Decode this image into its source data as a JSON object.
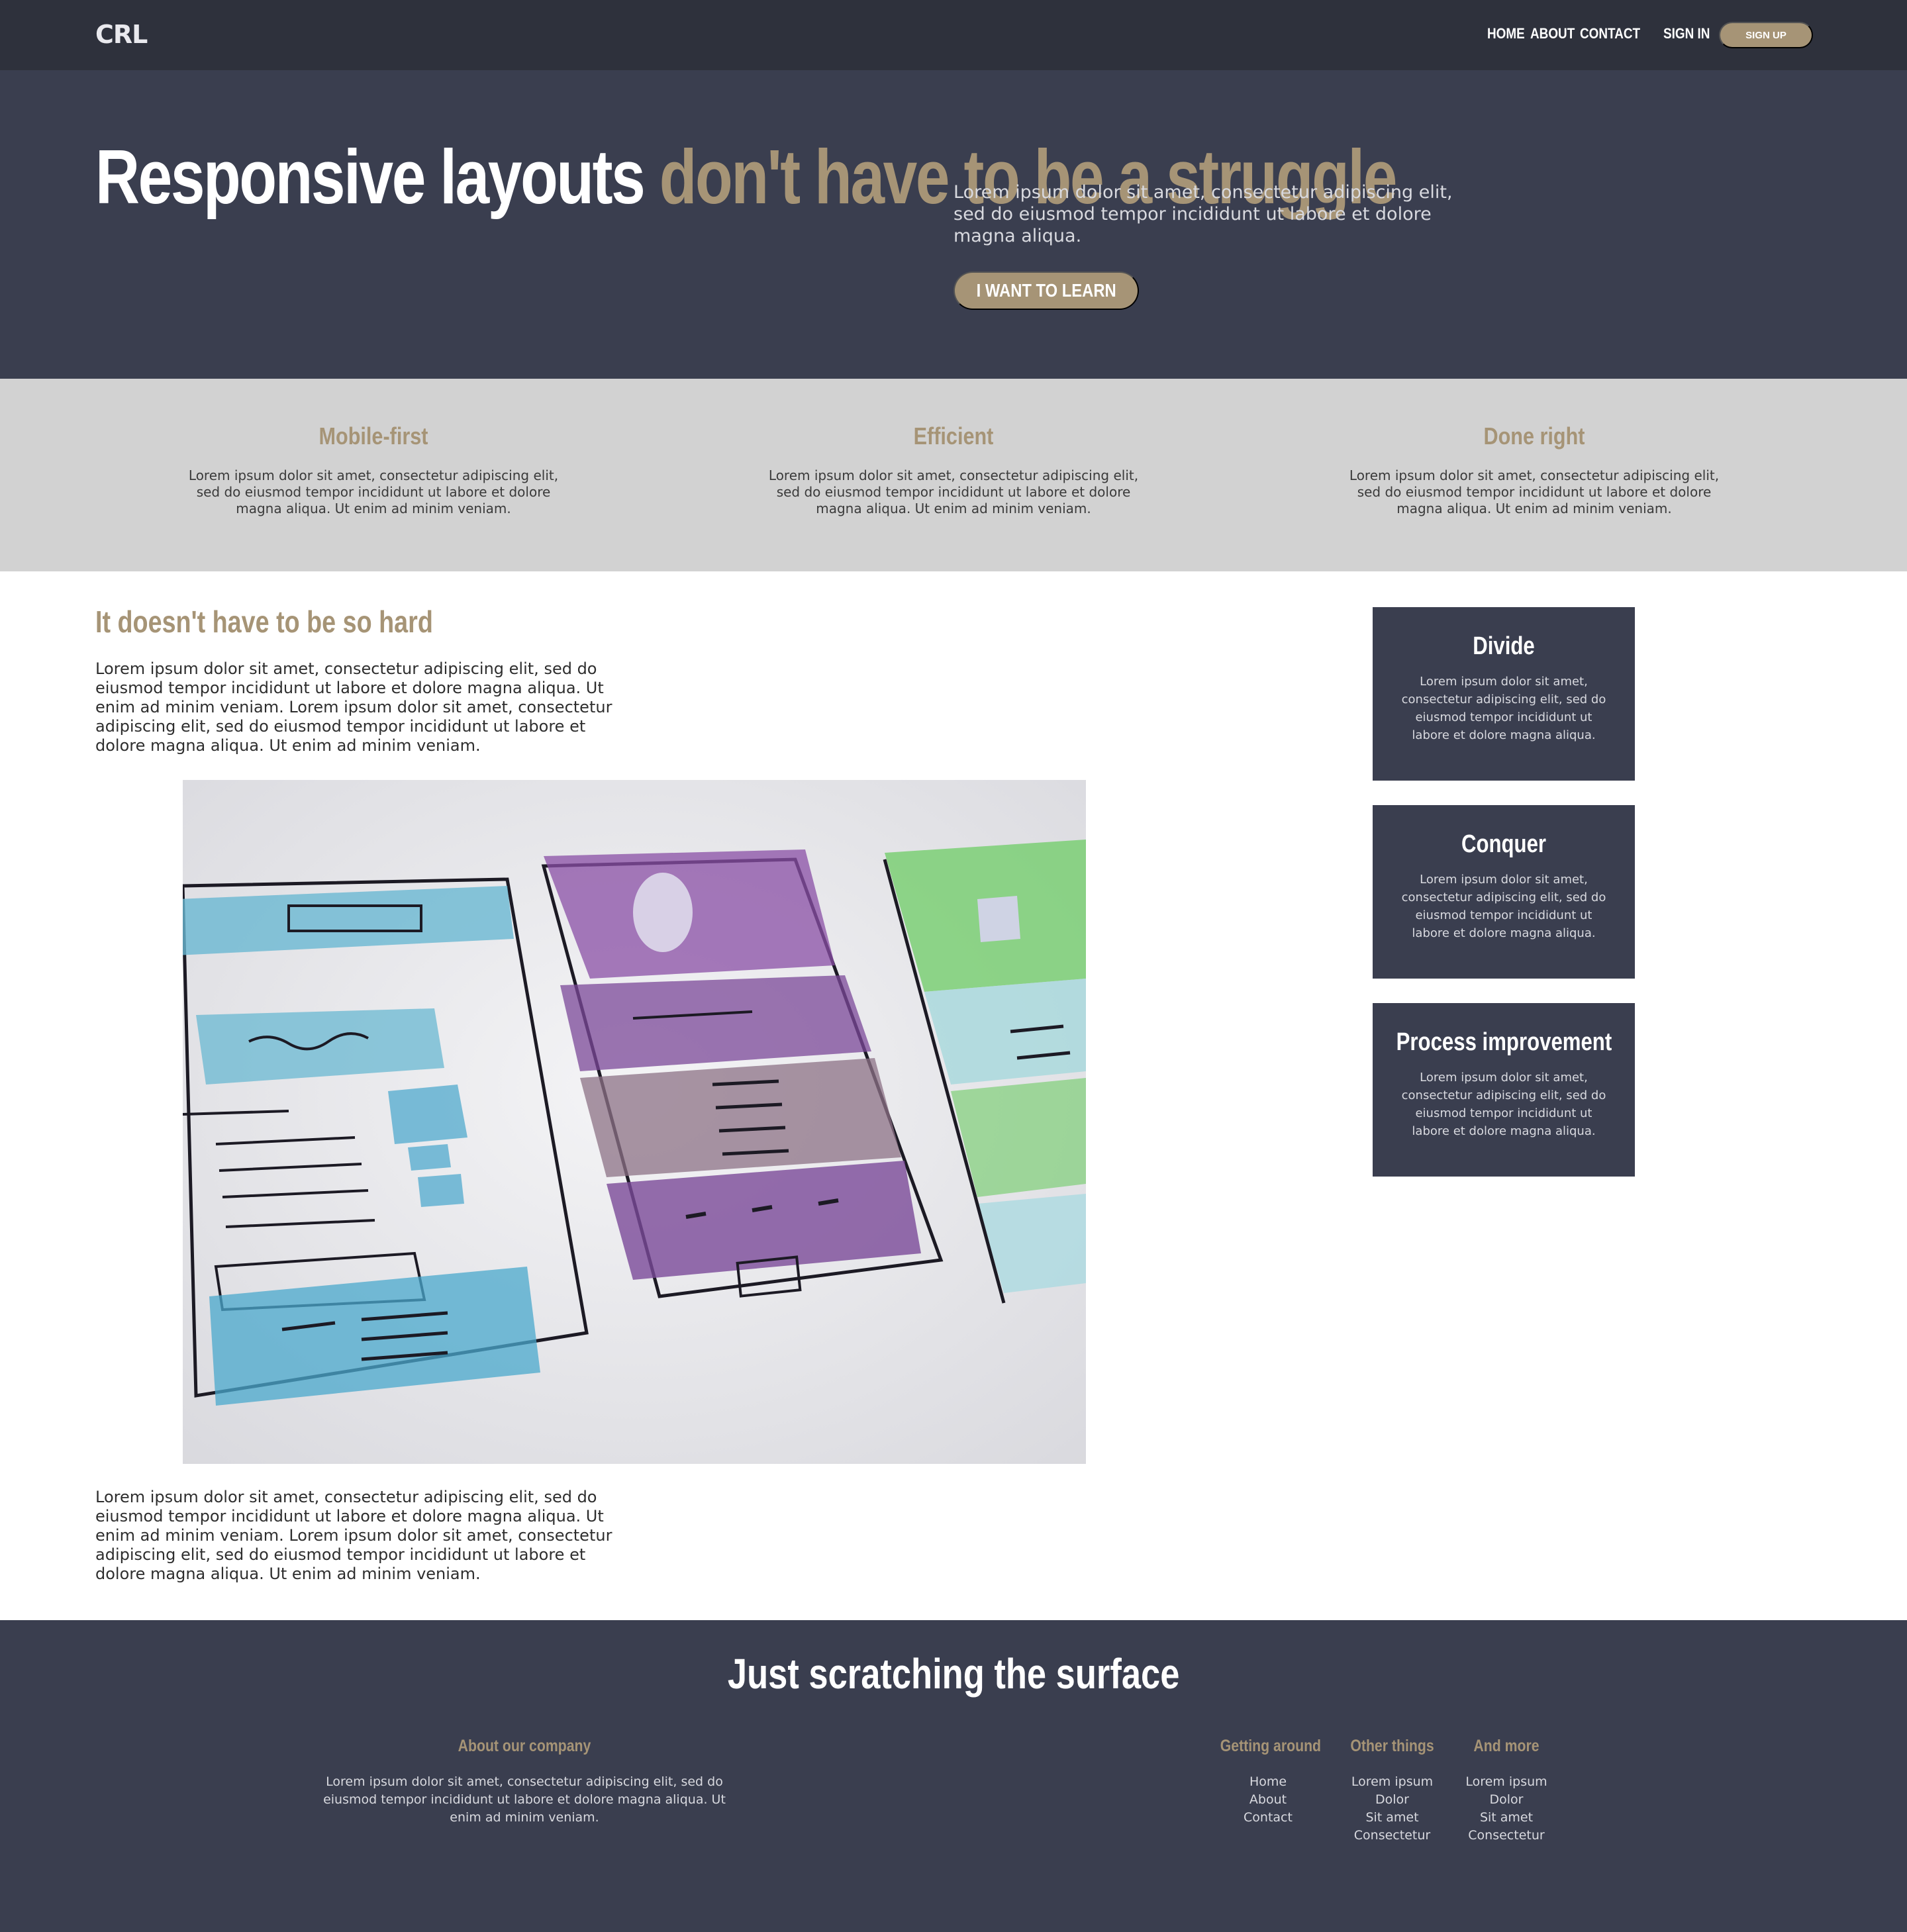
{
  "nav": {
    "logo": "CRL",
    "links": [
      "HOME",
      "ABOUT",
      "CONTACT"
    ],
    "sign_in": "SIGN IN",
    "sign_up": "SIGN UP"
  },
  "hero": {
    "title_part1": "Responsive layouts ",
    "title_part2": "don't have to be a struggle",
    "text": "Lorem ipsum dolor sit amet, consectetur adipiscing elit, sed do eiusmod tempor incididunt ut labore et dolore magna aliqua.",
    "button": "I WANT TO LEARN"
  },
  "features": [
    {
      "title": "Mobile-first",
      "text": "Lorem ipsum dolor sit amet, consectetur adipiscing elit, sed do eiusmod tempor incididunt ut labore et dolore magna aliqua. Ut enim ad minim veniam."
    },
    {
      "title": "Efficient",
      "text": "Lorem ipsum dolor sit amet, consectetur adipiscing elit, sed do eiusmod tempor incididunt ut labore et dolore magna aliqua. Ut enim ad minim veniam."
    },
    {
      "title": "Done right",
      "text": "Lorem ipsum dolor sit amet, consectetur adipiscing elit, sed do eiusmod tempor incididunt ut labore et dolore magna aliqua. Ut enim ad minim veniam."
    }
  ],
  "main": {
    "heading": "It doesn't have to be so hard",
    "para1": "Lorem ipsum dolor sit amet, consectetur adipiscing elit, sed do eiusmod tempor incididunt ut labore et dolore magna aliqua. Ut enim ad minim veniam. Lorem ipsum dolor sit amet, consectetur adipiscing elit, sed do eiusmod tempor incididunt ut labore et dolore magna aliqua. Ut enim ad minim veniam.",
    "para2": "Lorem ipsum dolor sit amet, consectetur adipiscing elit, sed do eiusmod tempor incididunt ut labore et dolore magna aliqua. Ut enim ad minim veniam. Lorem ipsum dolor sit amet, consectetur adipiscing elit, sed do eiusmod tempor incididunt ut labore et dolore magna aliqua. Ut enim ad minim veniam."
  },
  "sidebar": [
    {
      "title": "Divide",
      "text": "Lorem ipsum dolor sit amet, consectetur adipiscing elit, sed do eiusmod tempor incididunt ut labore et dolore magna aliqua."
    },
    {
      "title": "Conquer",
      "text": "Lorem ipsum dolor sit amet, consectetur adipiscing elit, sed do eiusmod tempor incididunt ut labore et dolore magna aliqua."
    },
    {
      "title": "Process improvement",
      "text": "Lorem ipsum dolor sit amet, consectetur adipiscing elit, sed do eiusmod tempor incididunt ut labore et dolore magna aliqua."
    }
  ],
  "footer": {
    "title": "Just scratching the surface",
    "about": {
      "title": "About our company",
      "text": "Lorem ipsum dolor sit amet, consectetur adipiscing elit, sed do eiusmod tempor incididunt ut labore et dolore magna aliqua. Ut enim ad minim veniam."
    },
    "columns": [
      {
        "title": "Getting around",
        "items": [
          "Home",
          "About",
          "Contact"
        ]
      },
      {
        "title": "Other things",
        "items": [
          "Lorem ipsum",
          "Dolor",
          "Sit amet",
          "Consectetur"
        ]
      },
      {
        "title": "And more",
        "items": [
          "Lorem ipsum",
          "Dolor",
          "Sit amet",
          "Consectetur"
        ]
      }
    ]
  },
  "colors": {
    "nav_bg": "#2e313c",
    "primary_bg": "#3a3e4f",
    "accent": "#a69476",
    "features_bg": "#d2d2d2"
  }
}
